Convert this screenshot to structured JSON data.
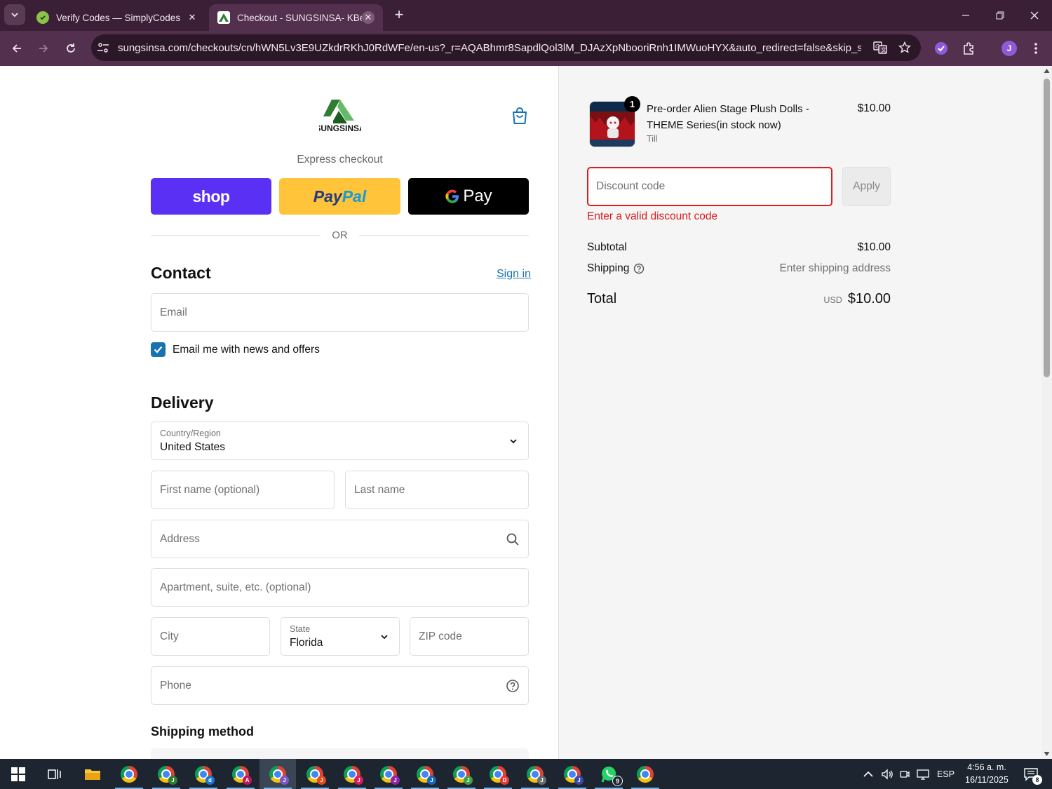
{
  "browser": {
    "tabs": [
      {
        "title": "Verify Codes — SimplyCodes",
        "active": false
      },
      {
        "title": "Checkout - SUNGSINSA- KBeau",
        "active": true
      }
    ],
    "url": "sungsinsa.com/checkouts/cn/hWN5Lv3E9UZkdrRKhJ0RdWFe/en-us?_r=AQABhmr8SapdlQol3lM_DJAzXpNbooriRnh1IMWuoHYX&auto_redirect=false&skip_sh...",
    "profile_initial": "J"
  },
  "checkout": {
    "brand": "SUNGSINSA",
    "express_label": "Express checkout",
    "shop_label": "shop",
    "paypal_label_1": "Pay",
    "paypal_label_2": "Pal",
    "gpay_label": "Pay",
    "or_label": "OR",
    "contact": {
      "heading": "Contact",
      "sign_in": "Sign in",
      "email_placeholder": "Email",
      "news_label": "Email me with news and offers",
      "news_checked": true
    },
    "delivery": {
      "heading": "Delivery",
      "country_label": "Country/Region",
      "country_value": "United States",
      "first_name_placeholder": "First name (optional)",
      "last_name_placeholder": "Last name",
      "address_placeholder": "Address",
      "apartment_placeholder": "Apartment, suite, etc. (optional)",
      "city_placeholder": "City",
      "state_label": "State",
      "state_value": "Florida",
      "zip_placeholder": "ZIP code",
      "phone_placeholder": "Phone"
    },
    "shipping_method_heading": "Shipping method"
  },
  "summary": {
    "item": {
      "quantity": "1",
      "name": "Pre-order Alien Stage Plush Dolls - THEME Series(in stock now)",
      "variant": "Till",
      "price": "$10.00"
    },
    "discount_placeholder": "Discount code",
    "apply_label": "Apply",
    "discount_error": "Enter a valid discount code",
    "subtotal_label": "Subtotal",
    "subtotal_value": "$10.00",
    "shipping_label": "Shipping",
    "shipping_value": "Enter shipping address",
    "total_label": "Total",
    "total_currency": "USD",
    "total_value": "$10.00"
  },
  "taskbar": {
    "whatsapp_badge": "9",
    "language": "ESP",
    "time": "4:56 a. m.",
    "date": "16/11/2025",
    "notifications": "8"
  },
  "colors": {
    "accent": "#1773b0",
    "error": "#dd1d1d",
    "shop": "#5a31f4",
    "paypal": "#ffc439",
    "tabbar": "#3a1f36"
  }
}
